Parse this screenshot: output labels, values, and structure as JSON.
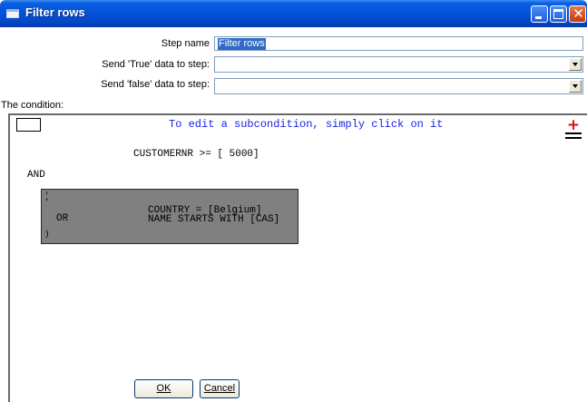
{
  "window": {
    "title": "Filter rows"
  },
  "form": {
    "step_name_label": "Step name",
    "step_name_value": "Filter rows",
    "true_label": "Send 'True' data to step:",
    "true_value": "",
    "false_label": "Send 'false' data to step:",
    "false_value": ""
  },
  "condition": {
    "label": "The condition:",
    "hint": "To edit a subcondition, simply click on it",
    "first": "CUSTOMERNR >= [ 5000]",
    "operator": "AND",
    "sub": {
      "mark_top1": "'",
      "mark_top2": "'",
      "operator": "OR",
      "mark_bottom": ")",
      "line1": "COUNTRY = [Belgium]",
      "line2": "NAME STARTS WITH [CAS]"
    }
  },
  "buttons": {
    "ok": "OK",
    "cancel": "Cancel"
  },
  "icons": [
    "window-icon",
    "minimize-icon",
    "maximize-icon",
    "close-icon",
    "add-condition-icon",
    "dropdown-arrow-icon"
  ]
}
